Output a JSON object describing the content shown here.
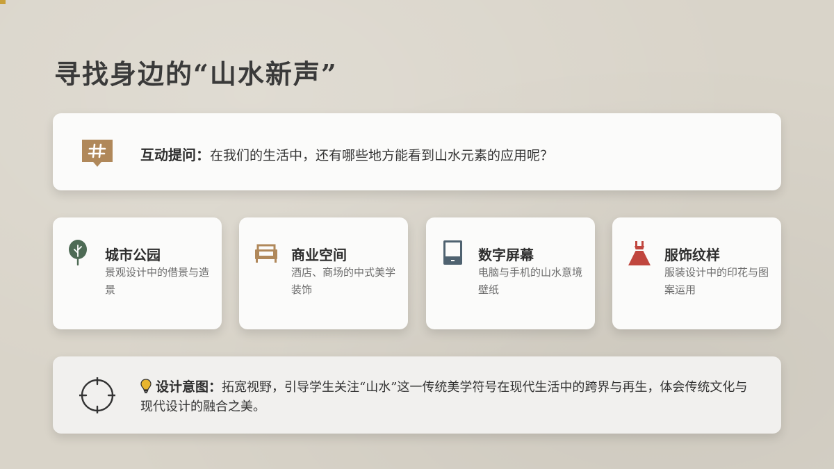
{
  "title": "寻找身边的“山水新声”",
  "question": {
    "label": "互动提问：",
    "text": "在我们的生活中，还有哪些地方能看到山水元素的应用呢？"
  },
  "items": [
    {
      "title": "城市公园",
      "desc": "景观设计中的借景与造景",
      "icon": "tree-icon",
      "color": "#4e6b55"
    },
    {
      "title": "商业空间",
      "desc": "酒店、商场的中式美学装饰",
      "icon": "sofa-icon",
      "color": "#b0885a"
    },
    {
      "title": "数字屏幕",
      "desc": "电脑与手机的山水意境壁纸",
      "icon": "phone-icon",
      "color": "#4f6270"
    },
    {
      "title": "服饰纹样",
      "desc": "服装设计中的印花与图案运用",
      "icon": "dress-icon",
      "color": "#c0463e"
    }
  ],
  "intent": {
    "label": "设计意图：",
    "text": "拓宽视野，引导学生关注“山水”这一传统美学符号在现代生活中的跨界与再生，体会传统文化与现代设计的融合之美。"
  },
  "colors": {
    "accent": "#b0885a",
    "background": "#d9d4c9",
    "bulb": "#e8b52e"
  }
}
